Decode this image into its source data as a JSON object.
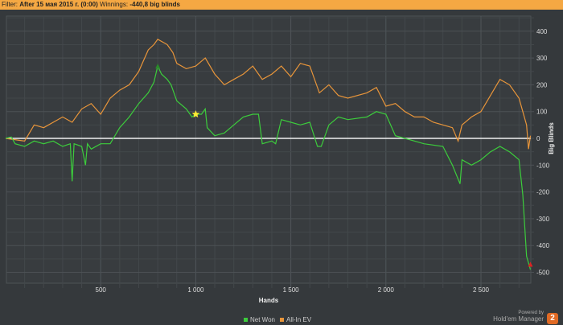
{
  "filter": {
    "label": "Filter:",
    "value": "After 15 мая 2015 г. (0:00)",
    "winnings_label": "Winnings:",
    "winnings_value": "-440,8 big blinds"
  },
  "branding": {
    "powered": "Powered by",
    "product": "Hold'em Manager",
    "logo": "2"
  },
  "chart_data": {
    "type": "line",
    "xlabel": "Hands",
    "ylabel": "Big Blinds",
    "xlim": [
      0,
      2760
    ],
    "ylim": [
      -550,
      480
    ],
    "xticks": [
      500,
      1000,
      1500,
      2000,
      2500
    ],
    "xtick_labels": [
      "500",
      "1 000",
      "1 500",
      "2 000",
      "2 500"
    ],
    "yticks": [
      400,
      300,
      200,
      100,
      0,
      -100,
      -200,
      -300,
      -400,
      -500
    ],
    "grid": true,
    "legend": "bottom-center",
    "series": [
      {
        "name": "Net Won",
        "color": "#3ccc3c",
        "points": [
          [
            0,
            0
          ],
          [
            30,
            5
          ],
          [
            50,
            -20
          ],
          [
            100,
            -30
          ],
          [
            150,
            -10
          ],
          [
            200,
            -20
          ],
          [
            250,
            -10
          ],
          [
            300,
            -30
          ],
          [
            340,
            -20
          ],
          [
            350,
            -160
          ],
          [
            360,
            -20
          ],
          [
            400,
            -30
          ],
          [
            420,
            -100
          ],
          [
            430,
            -20
          ],
          [
            450,
            -40
          ],
          [
            500,
            -20
          ],
          [
            550,
            -20
          ],
          [
            600,
            40
          ],
          [
            650,
            80
          ],
          [
            700,
            130
          ],
          [
            750,
            170
          ],
          [
            780,
            210
          ],
          [
            800,
            270
          ],
          [
            820,
            240
          ],
          [
            850,
            220
          ],
          [
            870,
            200
          ],
          [
            900,
            140
          ],
          [
            950,
            110
          ],
          [
            980,
            80
          ],
          [
            1000,
            90
          ],
          [
            1030,
            90
          ],
          [
            1050,
            110
          ],
          [
            1060,
            40
          ],
          [
            1100,
            10
          ],
          [
            1150,
            20
          ],
          [
            1200,
            50
          ],
          [
            1250,
            80
          ],
          [
            1300,
            90
          ],
          [
            1330,
            90
          ],
          [
            1350,
            -20
          ],
          [
            1400,
            -10
          ],
          [
            1420,
            -20
          ],
          [
            1450,
            70
          ],
          [
            1500,
            60
          ],
          [
            1550,
            50
          ],
          [
            1600,
            60
          ],
          [
            1640,
            -30
          ],
          [
            1660,
            -30
          ],
          [
            1700,
            50
          ],
          [
            1750,
            80
          ],
          [
            1800,
            70
          ],
          [
            1900,
            80
          ],
          [
            1950,
            100
          ],
          [
            2000,
            90
          ],
          [
            2050,
            10
          ],
          [
            2100,
            0
          ],
          [
            2200,
            -20
          ],
          [
            2300,
            -30
          ],
          [
            2350,
            -100
          ],
          [
            2390,
            -170
          ],
          [
            2400,
            -80
          ],
          [
            2450,
            -100
          ],
          [
            2500,
            -80
          ],
          [
            2550,
            -50
          ],
          [
            2600,
            -30
          ],
          [
            2650,
            -50
          ],
          [
            2700,
            -80
          ],
          [
            2720,
            -210
          ],
          [
            2740,
            -440
          ],
          [
            2760,
            -490
          ]
        ]
      },
      {
        "name": "All-In EV",
        "color": "#e8953a",
        "points": [
          [
            0,
            0
          ],
          [
            100,
            -10
          ],
          [
            150,
            50
          ],
          [
            200,
            40
          ],
          [
            300,
            80
          ],
          [
            350,
            60
          ],
          [
            400,
            110
          ],
          [
            450,
            130
          ],
          [
            500,
            90
          ],
          [
            550,
            150
          ],
          [
            600,
            180
          ],
          [
            650,
            200
          ],
          [
            700,
            250
          ],
          [
            750,
            330
          ],
          [
            780,
            350
          ],
          [
            800,
            370
          ],
          [
            850,
            350
          ],
          [
            880,
            320
          ],
          [
            900,
            280
          ],
          [
            950,
            260
          ],
          [
            1000,
            270
          ],
          [
            1050,
            300
          ],
          [
            1100,
            240
          ],
          [
            1150,
            200
          ],
          [
            1200,
            220
          ],
          [
            1250,
            240
          ],
          [
            1300,
            270
          ],
          [
            1350,
            220
          ],
          [
            1400,
            240
          ],
          [
            1450,
            270
          ],
          [
            1500,
            230
          ],
          [
            1550,
            280
          ],
          [
            1600,
            270
          ],
          [
            1650,
            170
          ],
          [
            1700,
            200
          ],
          [
            1750,
            160
          ],
          [
            1800,
            150
          ],
          [
            1900,
            170
          ],
          [
            1950,
            190
          ],
          [
            2000,
            120
          ],
          [
            2050,
            130
          ],
          [
            2100,
            100
          ],
          [
            2150,
            80
          ],
          [
            2200,
            80
          ],
          [
            2250,
            60
          ],
          [
            2300,
            50
          ],
          [
            2350,
            40
          ],
          [
            2380,
            -10
          ],
          [
            2400,
            50
          ],
          [
            2450,
            80
          ],
          [
            2500,
            100
          ],
          [
            2550,
            160
          ],
          [
            2600,
            220
          ],
          [
            2650,
            200
          ],
          [
            2700,
            150
          ],
          [
            2720,
            100
          ],
          [
            2740,
            50
          ],
          [
            2750,
            -40
          ],
          [
            2760,
            10
          ]
        ]
      }
    ],
    "markers": [
      {
        "name": "star",
        "x": 1000,
        "y": 90,
        "color": "#ffee33"
      },
      {
        "name": "peak",
        "x": 800,
        "y": 270,
        "color": "#2a8a2a"
      },
      {
        "name": "end",
        "x": 2760,
        "y": -470,
        "color": "#dd2222"
      }
    ]
  }
}
